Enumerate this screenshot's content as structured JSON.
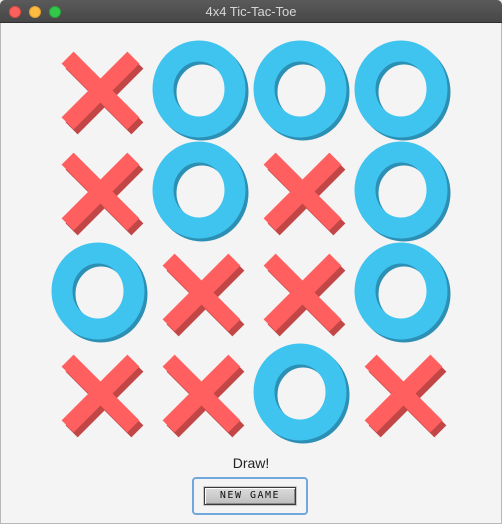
{
  "window": {
    "title": "4x4 Tic-Tac-Toe"
  },
  "board": {
    "size": 4,
    "cells": [
      [
        "X",
        "O",
        "O",
        "O"
      ],
      [
        "X",
        "O",
        "X",
        "O"
      ],
      [
        "O",
        "X",
        "X",
        "O"
      ],
      [
        "X",
        "X",
        "O",
        "X"
      ]
    ],
    "colors": {
      "x": "#ff5f5f",
      "x_shade": "#c24646",
      "o": "#3fc4f0",
      "o_shade": "#2c8fb4"
    }
  },
  "status": {
    "text": "Draw!"
  },
  "new_game_button": {
    "label": "NEW GAME"
  }
}
